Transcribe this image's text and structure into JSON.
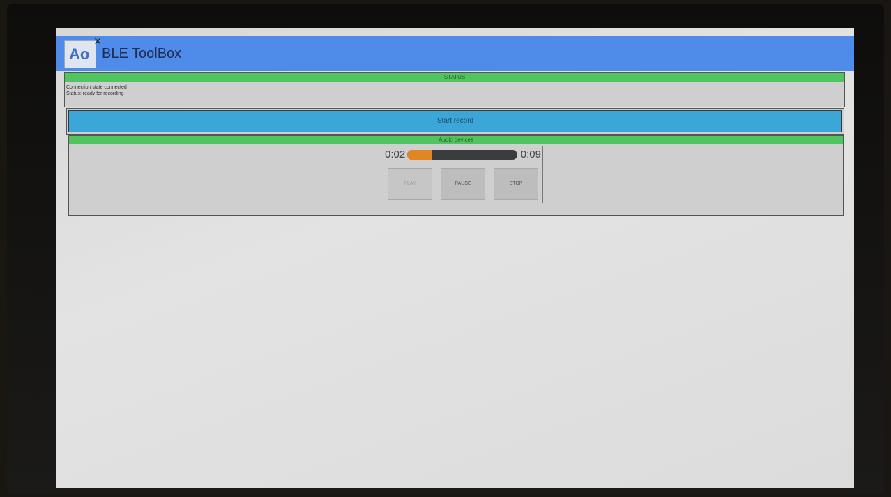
{
  "app": {
    "title": "BLE ToolBox",
    "logo_text": "Ao"
  },
  "status_panel": {
    "header": "STATUS",
    "lines": [
      "Connection state connected",
      "Status: ready for recording"
    ]
  },
  "start_button": {
    "label": "Start record"
  },
  "audio_panel": {
    "header": "Audio devices",
    "player": {
      "current_time": "0:02",
      "duration": "0:09",
      "progress": 0.22,
      "buttons": {
        "play": "PLAY",
        "pause": "PAUSE",
        "stop": "STOP"
      }
    }
  },
  "colors": {
    "titlebar": "#4f8be9",
    "section_header": "#4fc45f",
    "start_button": "#3ba7d8",
    "progress_fill": "#e08623",
    "progress_track": "#3b3c3d"
  },
  "icons": {
    "app_logo": "app-logo-icon",
    "close": "close-icon"
  }
}
